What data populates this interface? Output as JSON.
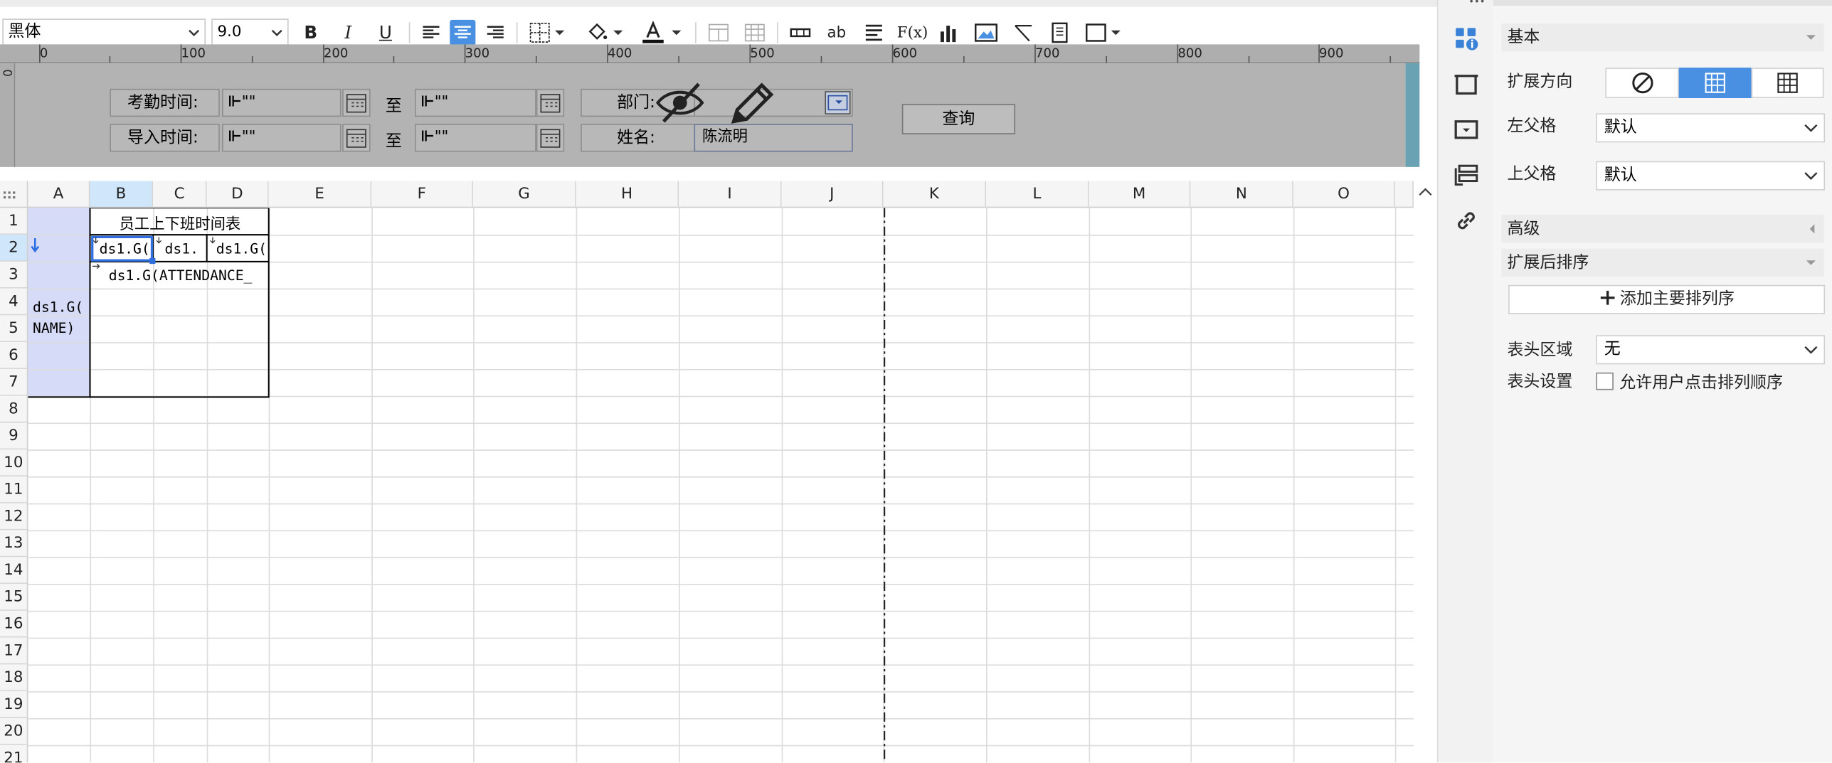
{
  "toolbar": {
    "font_name": "黑体",
    "font_size": "9.0",
    "bold": "B",
    "italic": "I",
    "underline": "U",
    "text_ab": "ab",
    "formula": "F(x)"
  },
  "ruler": {
    "labels": [
      "0",
      "100",
      "200",
      "300",
      "400",
      "500",
      "600",
      "700",
      "800",
      "900"
    ],
    "v_label": "0"
  },
  "params": {
    "attendance_label": "考勤时间:",
    "import_label": "导入时间:",
    "to_label_1": "至",
    "to_label_2": "至",
    "dept_label": "部门:",
    "name_label": "姓名:",
    "name_value": "陈流明",
    "date_placeholder": "\"\"",
    "query_button": "查询"
  },
  "grid": {
    "columns": [
      "A",
      "B",
      "C",
      "D",
      "E",
      "F",
      "G",
      "H",
      "I",
      "J",
      "K",
      "L",
      "M",
      "N",
      "O"
    ],
    "rows": [
      "1",
      "2",
      "3",
      "4",
      "5",
      "6",
      "7",
      "8",
      "9",
      "10",
      "11",
      "12",
      "13",
      "14",
      "15",
      "16",
      "17",
      "18",
      "19",
      "20",
      "21"
    ],
    "title_cell": "员工上下班时间表",
    "b2": "ds1.G(",
    "c2": "ds1.",
    "d2": "ds1.G(",
    "b3": "ds1.G(ATTENDANCE_",
    "a_line1": "ds1.G(",
    "a_line2": "NAME)"
  },
  "panel": {
    "basic": "基本",
    "expand_direction": "扩展方向",
    "left_parent": "左父格",
    "left_parent_value": "默认",
    "top_parent": "上父格",
    "top_parent_value": "默认",
    "advanced": "高级",
    "sort_after_expand": "扩展后排序",
    "add_sort_button": "添加主要排列序",
    "header_area": "表头区域",
    "header_area_value": "无",
    "header_settings": "表头设置",
    "allow_user_sort": "允许用户点击排列顺序"
  },
  "colors": {
    "accent": "#4a90e2",
    "param_bg": "#b3b3b3",
    "selected_col": "#d6dcf8"
  },
  "icons": [
    "align-left-icon",
    "align-center-icon",
    "align-right-icon",
    "border-icon",
    "fill-color-icon",
    "font-color-icon",
    "merge-icon",
    "unmerge-icon",
    "insert-row-icon",
    "text-icon",
    "wrap-icon",
    "formula-icon",
    "chart-icon",
    "image-icon",
    "slash-icon",
    "subreport-icon",
    "frame-icon",
    "cell-attr-icon",
    "cell-element-icon",
    "widget-icon",
    "condition-icon",
    "hyperlink-icon",
    "hide-icon",
    "edit-icon"
  ]
}
